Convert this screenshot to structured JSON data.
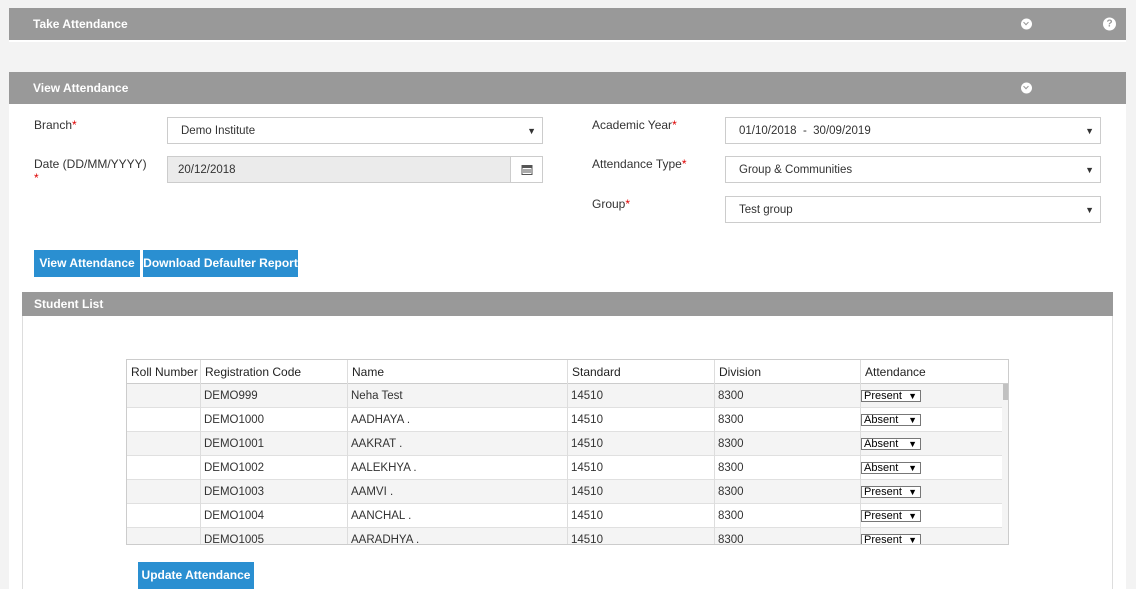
{
  "take_attendance": {
    "title": "Take Attendance"
  },
  "view_attendance": {
    "title": "View Attendance"
  },
  "form": {
    "branch_label": "Branch",
    "branch_value": "Demo Institute",
    "date_label_line1": "Date (DD/MM/YYYY)",
    "date_value": "20/12/2018",
    "academic_year_label": "Academic Year",
    "academic_year_value": "01/10/2018  -  30/09/2019",
    "attendance_type_label": "Attendance Type",
    "attendance_type_value": "Group & Communities",
    "group_label": "Group",
    "group_value": "Test group",
    "required_mark": "*"
  },
  "buttons": {
    "view_attendance": "View Attendance",
    "download_defaulter": "Download Defaulter Report",
    "update_attendance": "Update Attendance"
  },
  "student_list": {
    "title": "Student List",
    "columns": [
      "Roll Number",
      "Registration Code",
      "Name",
      "Standard",
      "Division",
      "Attendance"
    ],
    "rows": [
      {
        "roll": "",
        "code": "DEMO999",
        "name": "Neha Test",
        "standard": "14510",
        "division": "8300",
        "attendance": "Present"
      },
      {
        "roll": "",
        "code": "DEMO1000",
        "name": "AADHAYA .",
        "standard": "14510",
        "division": "8300",
        "attendance": "Absent"
      },
      {
        "roll": "",
        "code": "DEMO1001",
        "name": "AAKRAT .",
        "standard": "14510",
        "division": "8300",
        "attendance": "Absent"
      },
      {
        "roll": "",
        "code": "DEMO1002",
        "name": "AALEKHYA .",
        "standard": "14510",
        "division": "8300",
        "attendance": "Absent"
      },
      {
        "roll": "",
        "code": "DEMO1003",
        "name": "AAMVI .",
        "standard": "14510",
        "division": "8300",
        "attendance": "Present"
      },
      {
        "roll": "",
        "code": "DEMO1004",
        "name": "AANCHAL .",
        "standard": "14510",
        "division": "8300",
        "attendance": "Present"
      },
      {
        "roll": "",
        "code": "DEMO1005",
        "name": "AARADHYA .",
        "standard": "14510",
        "division": "8300",
        "attendance": "Present"
      }
    ]
  }
}
